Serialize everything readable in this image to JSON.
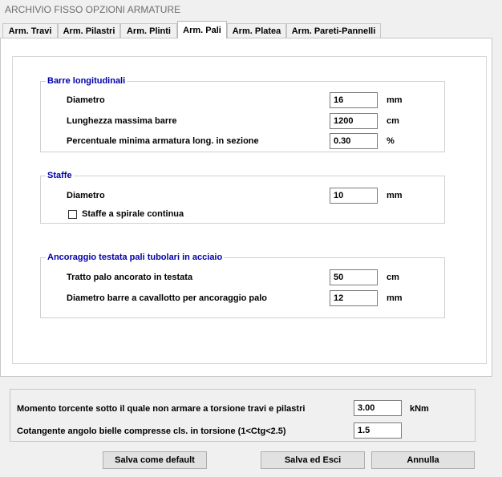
{
  "window": {
    "title": "ARCHIVIO FISSO OPZIONI ARMATURE"
  },
  "tabs": [
    {
      "label": "Arm. Travi",
      "active": false
    },
    {
      "label": "Arm. Pilastri",
      "active": false
    },
    {
      "label": "Arm. Plinti",
      "active": false
    },
    {
      "label": "Arm. Pali",
      "active": true
    },
    {
      "label": "Arm. Platea",
      "active": false
    },
    {
      "label": "Arm. Pareti-Pannelli",
      "active": false
    }
  ],
  "barre_longitudinali": {
    "title": "Barre longitudinali",
    "diametro": {
      "label": "Diametro",
      "value": "16",
      "unit": "mm"
    },
    "lunghezza": {
      "label": "Lunghezza massima barre",
      "value": "1200",
      "unit": "cm"
    },
    "percentuale": {
      "label": "Percentuale minima armatura long. in sezione",
      "value": "0.30",
      "unit": "%"
    }
  },
  "staffe": {
    "title": "Staffe",
    "diametro": {
      "label": "Diametro",
      "value": "10",
      "unit": "mm"
    },
    "spirale": {
      "label": "Staffe a spirale continua",
      "checked": false
    }
  },
  "ancoraggio": {
    "title": "Ancoraggio testata pali tubolari in acciaio",
    "tratto": {
      "label": "Tratto palo ancorato in testata",
      "value": "50",
      "unit": "cm"
    },
    "diametro_cavallotto": {
      "label": "Diametro barre a cavallotto per ancoraggio palo",
      "value": "12",
      "unit": "mm"
    }
  },
  "torsione": {
    "momento": {
      "label": "Momento torcente sotto il quale non armare a torsione travi e pilastri",
      "value": "3.00",
      "unit": "kNm"
    },
    "cotangente": {
      "label": "Cotangente angolo bielle compresse cls. in torsione  (1<Ctg<2.5)",
      "value": "1.5"
    }
  },
  "buttons": {
    "salva_default": "Salva come default",
    "salva_esci": "Salva ed Esci",
    "annulla": "Annulla"
  }
}
